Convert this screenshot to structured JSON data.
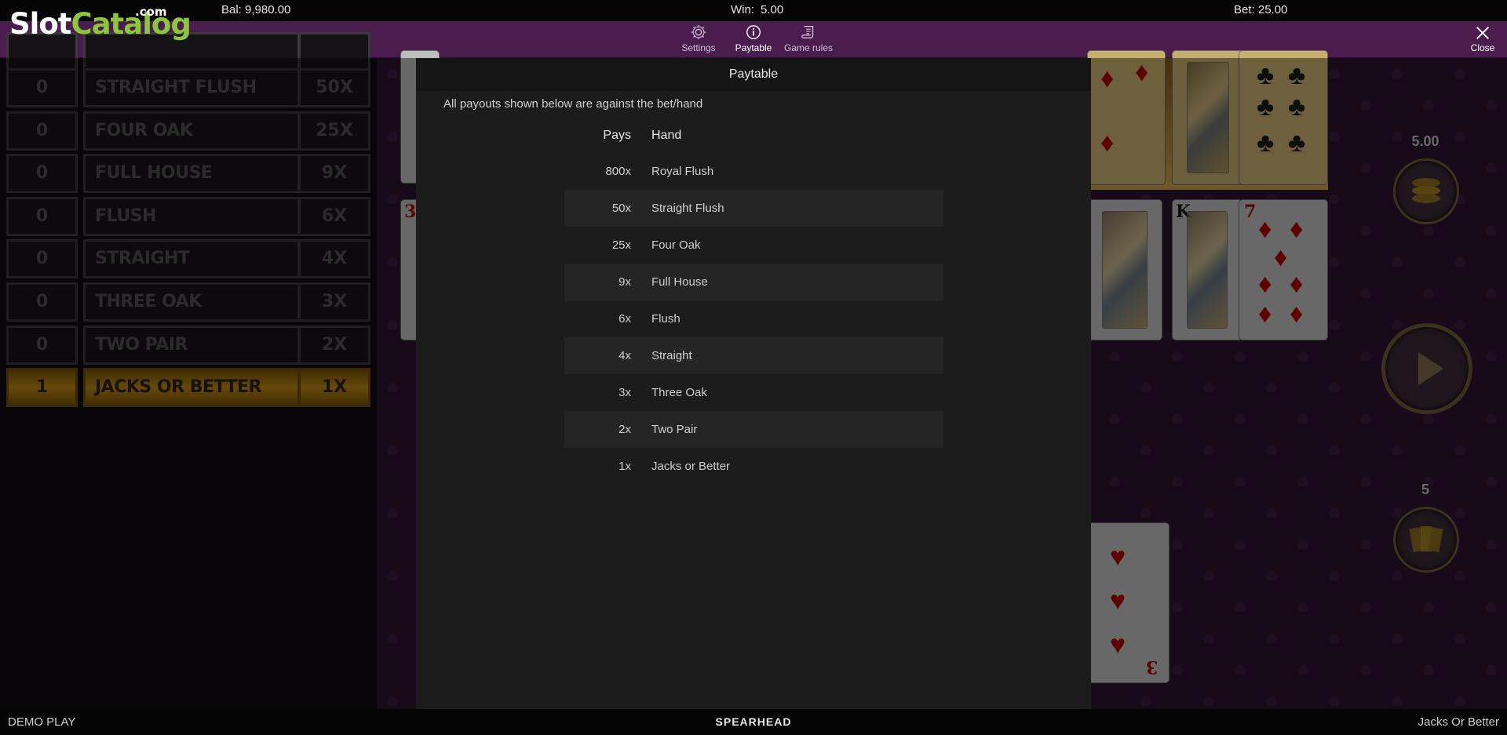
{
  "logo": {
    "part1": "Slot",
    "part2": "Catalog",
    "suffix": ".com"
  },
  "status": {
    "balance": "Bal: 9,980.00",
    "win_label": "Win:",
    "win_value": "5.00",
    "bet": "Bet: 25.00"
  },
  "menu": {
    "settings": "Settings",
    "paytable": "Paytable",
    "game_rules": "Game rules",
    "close": "Close"
  },
  "left_paytable": [
    {
      "count": "0",
      "hand": "STRAIGHT FLUSH",
      "mult": "50X"
    },
    {
      "count": "0",
      "hand": "FOUR OAK",
      "mult": "25X"
    },
    {
      "count": "0",
      "hand": "FULL HOUSE",
      "mult": "9X"
    },
    {
      "count": "0",
      "hand": "FLUSH",
      "mult": "6X"
    },
    {
      "count": "0",
      "hand": "STRAIGHT",
      "mult": "4X"
    },
    {
      "count": "0",
      "hand": "THREE OAK",
      "mult": "3X"
    },
    {
      "count": "0",
      "hand": "TWO PAIR",
      "mult": "2X"
    },
    {
      "count": "1",
      "hand": "JACKS OR BETTER",
      "mult": "1X"
    }
  ],
  "controls": {
    "coin_value": "5.00",
    "hands_value": "5"
  },
  "modal": {
    "title": "Paytable",
    "subtitle": "All payouts shown below are against the bet/hand",
    "col_pays": "Pays",
    "col_hand": "Hand",
    "rows": [
      {
        "pays": "800x",
        "hand": "Royal Flush"
      },
      {
        "pays": "50x",
        "hand": "Straight Flush"
      },
      {
        "pays": "25x",
        "hand": "Four Oak"
      },
      {
        "pays": "9x",
        "hand": "Full House"
      },
      {
        "pays": "6x",
        "hand": "Flush"
      },
      {
        "pays": "4x",
        "hand": "Straight"
      },
      {
        "pays": "3x",
        "hand": "Three Oak"
      },
      {
        "pays": "2x",
        "hand": "Two Pair"
      },
      {
        "pays": "1x",
        "hand": "Jacks or Better"
      }
    ]
  },
  "footer": {
    "mode": "DEMO PLAY",
    "provider": "SPEARHEAD",
    "game": "Jacks Or Better"
  },
  "colors": {
    "menubar": "#4b1d4f",
    "highlight": "#b88616",
    "logo_green": "#8cc63f"
  }
}
